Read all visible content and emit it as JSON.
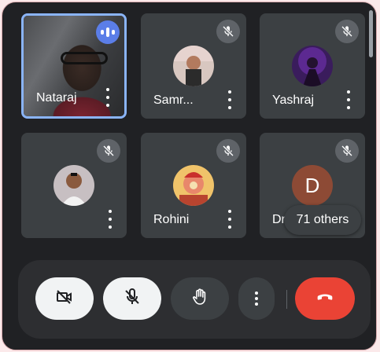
{
  "participants": [
    {
      "name": "Nataraj",
      "is_self": true,
      "speaking": true,
      "muted": false
    },
    {
      "name": "Samr...",
      "muted": true
    },
    {
      "name": "Yashraj",
      "muted": true
    },
    {
      "name": "",
      "muted": true
    },
    {
      "name": "Rohini",
      "muted": true
    },
    {
      "name": "Dr...",
      "avatar_letter": "D",
      "muted": true
    }
  ],
  "others_label": "71 others",
  "controls": {
    "camera": "camera-off-icon",
    "microphone": "mic-off-icon",
    "raise_hand": "raise-hand-icon",
    "more": "more-options-icon",
    "leave": "end-call-icon"
  },
  "colors": {
    "background": "#202124",
    "tile": "#3c4043",
    "active_speaker_border": "#8ab4f8",
    "end_call": "#ea4335",
    "speaking_indicator": "#5b7ee8"
  }
}
